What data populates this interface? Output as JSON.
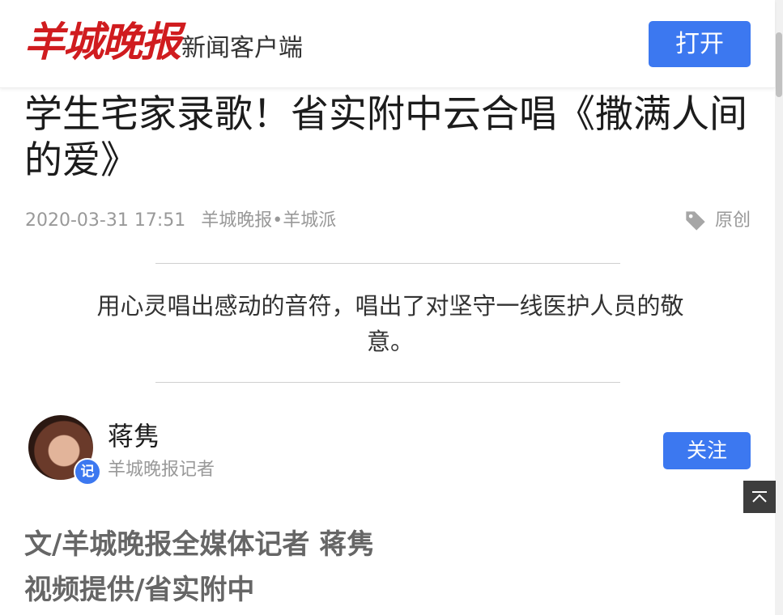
{
  "header": {
    "logo_text": "羊城晚报",
    "client_label": "新闻客户端",
    "open_label": "打开",
    "brand_color": "#d01c1f",
    "accent_color": "#3c78f0"
  },
  "article": {
    "title": "学生宅家录歌！省实附中云合唱《撒满人间的爱》",
    "datetime": "2020-03-31 17:51",
    "source": "羊城晚报•羊城派",
    "tag_icon": "tag-icon",
    "original_label": "原创",
    "summary": "用心灵唱出感动的音符，唱出了对坚守一线医护人员的敬意。",
    "body_lines": [
      "文/羊城晚报全媒体记者 蒋隽",
      "视频提供/省实附中"
    ]
  },
  "author": {
    "name": "蒋隽",
    "title": "羊城晚报记者",
    "badge": "记",
    "follow_label": "关注"
  },
  "back_to_top_icon": "back-to-top-icon"
}
